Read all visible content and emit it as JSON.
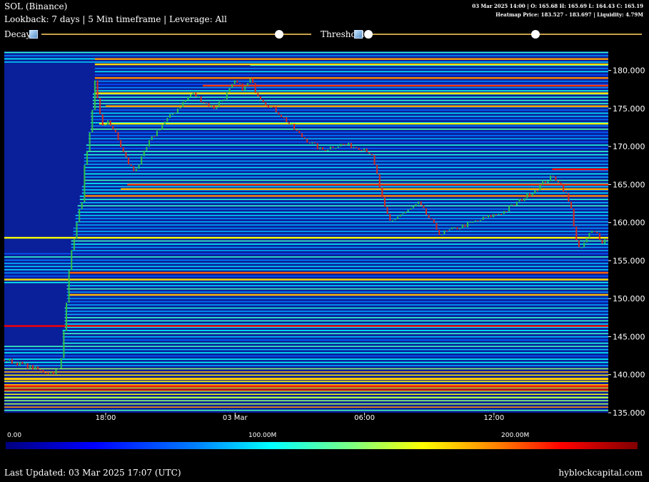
{
  "header": {
    "symbol": "SOL (Binance)",
    "subtitle": "Lookback: 7 days | 5 Min timeframe | Leverage: All",
    "ohlc": "03 Mar 2025 14:00 | O: 165.68 H: 165.69 L: 164.43 C: 165.19",
    "heatmap_info": "Heatmap Price: 183.527 - 183.697 | Liquidity: 4.79M"
  },
  "controls": {
    "decay_label": "Decay",
    "threshold_label": "Threshold",
    "decay_value": 0.88,
    "threshold_low": 0.0,
    "threshold_high": 0.61,
    "icon": "image-icon"
  },
  "colors": {
    "background": "#000000",
    "slider_track": "#c8a04a",
    "candle_up": "#2fbf4a",
    "candle_down": "#d42a1e"
  },
  "chart_data": {
    "type": "heatmap",
    "y_ticks": [
      "180.000",
      "175.000",
      "170.000",
      "165.000",
      "160.000",
      "155.000",
      "150.000",
      "145.000",
      "140.000",
      "135.000"
    ],
    "ylim": [
      135,
      182.5
    ],
    "x_ticks": [
      "18:00",
      "03 Mar",
      "06:00",
      "12:00"
    ],
    "x_tick_hours": [
      18,
      24,
      30,
      36
    ],
    "xlim_hours": [
      13.3,
      41.3
    ],
    "colorbar": {
      "ticks": [
        "0.00",
        "100.00M",
        "200.00M"
      ],
      "tick_values_m": [
        0,
        100,
        200
      ],
      "range_m": [
        0,
        250
      ]
    },
    "price_path": [
      [
        13.3,
        142.0
      ],
      [
        13.8,
        141.6
      ],
      [
        14.5,
        141.0
      ],
      [
        15.0,
        140.5
      ],
      [
        15.5,
        140.3
      ],
      [
        15.9,
        140.8
      ],
      [
        16.1,
        147.0
      ],
      [
        16.3,
        154.0
      ],
      [
        16.5,
        157.5
      ],
      [
        16.7,
        160.5
      ],
      [
        16.9,
        163.0
      ],
      [
        17.0,
        167.0
      ],
      [
        17.2,
        170.0
      ],
      [
        17.4,
        175.0
      ],
      [
        17.5,
        178.5
      ],
      [
        17.7,
        175.0
      ],
      [
        17.9,
        172.0
      ],
      [
        18.1,
        173.5
      ],
      [
        18.4,
        172.0
      ],
      [
        18.7,
        170.0
      ],
      [
        19.0,
        168.0
      ],
      [
        19.3,
        166.8
      ],
      [
        19.6,
        168.0
      ],
      [
        20.0,
        170.5
      ],
      [
        20.5,
        172.5
      ],
      [
        21.0,
        174.0
      ],
      [
        21.5,
        175.5
      ],
      [
        22.0,
        177.0
      ],
      [
        22.5,
        176.0
      ],
      [
        23.0,
        175.0
      ],
      [
        23.5,
        176.5
      ],
      [
        24.0,
        178.5
      ],
      [
        24.4,
        177.5
      ],
      [
        24.7,
        178.8
      ],
      [
        25.0,
        177.0
      ],
      [
        25.5,
        175.5
      ],
      [
        26.0,
        174.5
      ],
      [
        26.5,
        173.0
      ],
      [
        27.0,
        171.5
      ],
      [
        27.5,
        170.5
      ],
      [
        28.0,
        169.5
      ],
      [
        28.5,
        170.0
      ],
      [
        29.0,
        170.3
      ],
      [
        29.5,
        170.0
      ],
      [
        30.0,
        169.8
      ],
      [
        30.3,
        169.0
      ],
      [
        30.6,
        166.0
      ],
      [
        30.9,
        162.0
      ],
      [
        31.2,
        160.0
      ],
      [
        31.6,
        161.0
      ],
      [
        32.0,
        161.5
      ],
      [
        32.5,
        162.5
      ],
      [
        33.0,
        160.5
      ],
      [
        33.5,
        158.5
      ],
      [
        34.0,
        159.0
      ],
      [
        34.5,
        159.5
      ],
      [
        35.0,
        160.0
      ],
      [
        35.5,
        160.5
      ],
      [
        36.0,
        161.0
      ],
      [
        36.5,
        161.5
      ],
      [
        37.0,
        162.5
      ],
      [
        37.5,
        163.5
      ],
      [
        38.0,
        164.5
      ],
      [
        38.4,
        165.5
      ],
      [
        38.7,
        166.0
      ],
      [
        39.0,
        165.5
      ],
      [
        39.3,
        164.0
      ],
      [
        39.6,
        161.5
      ],
      [
        39.8,
        158.0
      ],
      [
        40.0,
        156.0
      ],
      [
        40.2,
        157.5
      ],
      [
        40.5,
        158.8
      ],
      [
        40.8,
        158.5
      ],
      [
        41.0,
        157.5
      ],
      [
        41.3,
        158.0
      ]
    ]
  },
  "footer": {
    "last_updated": "Last Updated: 03 Mar 2025 17:07 (UTC)",
    "brand": "hyblockcapital.com"
  }
}
